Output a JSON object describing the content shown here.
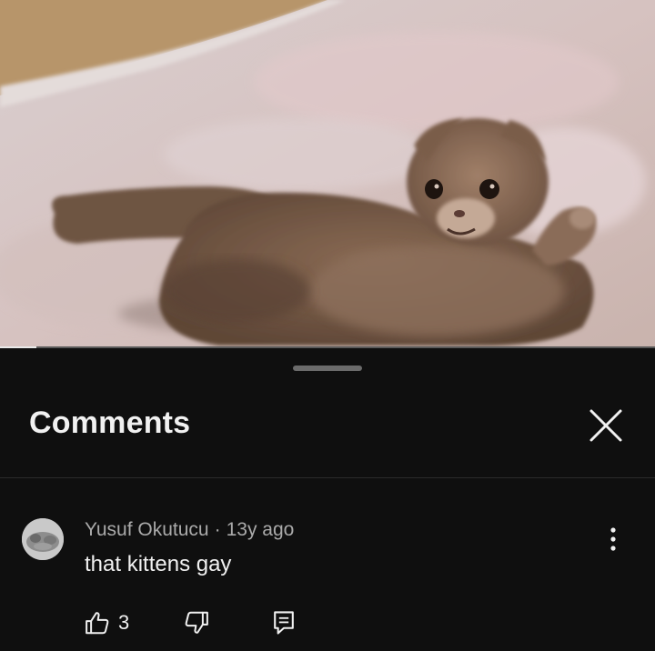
{
  "video": {
    "progress_fraction": 0.055
  },
  "comments_sheet": {
    "title": "Comments",
    "close_icon": "close-icon"
  },
  "comment": {
    "author": "Yusuf Okutucu",
    "separator": "·",
    "time_ago": "13y ago",
    "text": "that kittens gay",
    "like_count": "3",
    "icons": {
      "like": "thumbs-up-icon",
      "dislike": "thumbs-down-icon",
      "reply": "reply-icon",
      "more": "more-vertical-icon"
    }
  },
  "colors": {
    "sheet_background": "#0f0f0f",
    "primary_text": "#f1f1f1",
    "secondary_text": "#aaaaaa"
  }
}
